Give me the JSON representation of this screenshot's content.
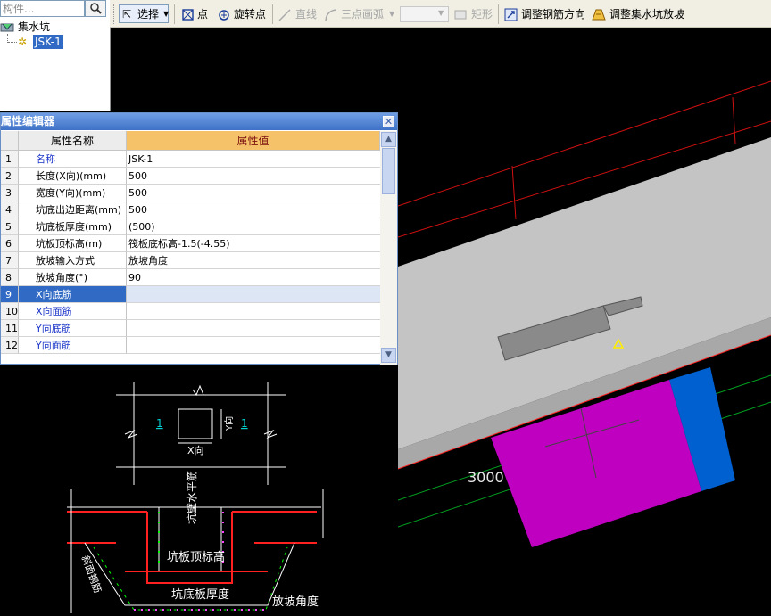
{
  "tree": {
    "search_placeholder": "构件...",
    "root_label": "集水坑",
    "child_label": "JSK-1"
  },
  "toolbar": {
    "select_label": "选择",
    "point_label": "点",
    "rotate_point_label": "旋转点",
    "line_label": "直线",
    "arc_label": "三点画弧",
    "rect_label": "矩形",
    "adjust_rebar_label": "调整钢筋方向",
    "adjust_slope_label": "调整集水坑放坡"
  },
  "property_editor": {
    "title": "属性编辑器",
    "col_name": "属性名称",
    "col_value": "属性值",
    "rows": [
      {
        "num": "1",
        "name": "名称",
        "value": "JSK-1",
        "blue": true
      },
      {
        "num": "2",
        "name": "长度(X向)(mm)",
        "value": "500",
        "blue": false
      },
      {
        "num": "3",
        "name": "宽度(Y向)(mm)",
        "value": "500",
        "blue": false
      },
      {
        "num": "4",
        "name": "坑底出边距离(mm)",
        "value": "500",
        "blue": false
      },
      {
        "num": "5",
        "name": "坑底板厚度(mm)",
        "value": "(500)",
        "blue": false
      },
      {
        "num": "6",
        "name": "坑板顶标高(m)",
        "value": "筏板底标高-1.5(-4.55)",
        "blue": false
      },
      {
        "num": "7",
        "name": "放坡输入方式",
        "value": "放坡角度",
        "blue": false
      },
      {
        "num": "8",
        "name": "放坡角度(°)",
        "value": "90",
        "blue": false
      },
      {
        "num": "9",
        "name": "X向底筋",
        "value": "",
        "blue": true,
        "selected": true
      },
      {
        "num": "10",
        "name": "X向面筋",
        "value": "",
        "blue": true
      },
      {
        "num": "11",
        "name": "Y向底筋",
        "value": "",
        "blue": true
      },
      {
        "num": "12",
        "name": "Y向面筋",
        "value": "",
        "blue": true
      }
    ]
  },
  "viewport": {
    "dimension_label": "3000"
  },
  "detail_drawing": {
    "section_mark": "1",
    "x_dir": "X向",
    "y_dir": "Y向",
    "wall_horiz_rebar": "坑壁水平筋",
    "slab_top_elev": "坑板顶标高",
    "slab_thickness": "坑底板厚度",
    "slope_angle": "放坡角度",
    "slope_rebar": "斜面钢筋"
  },
  "colors": {
    "selection": "#316ac5",
    "magenta_block": "#c000c0",
    "blue_block": "#0060d0",
    "slab_grey": "#c0c0c0"
  }
}
